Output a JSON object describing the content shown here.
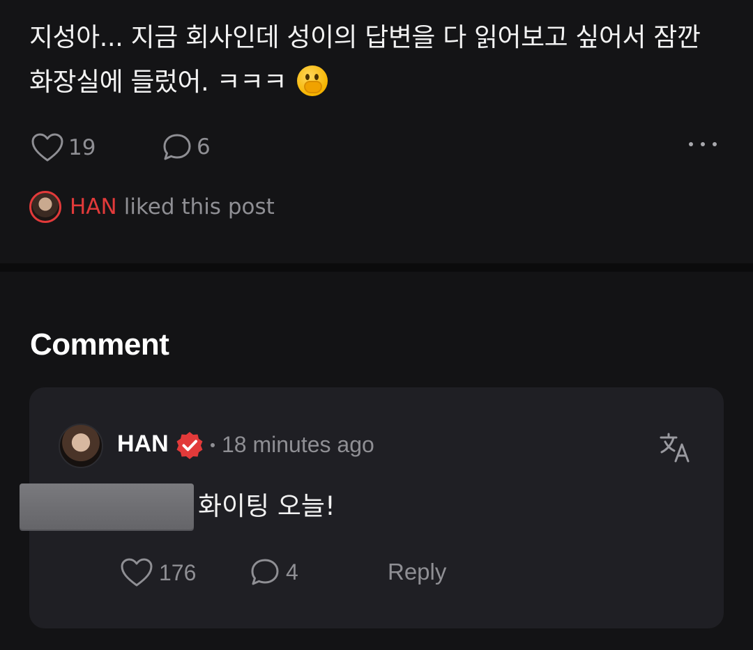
{
  "post": {
    "text": "지성아... 지금 회사인데 성이의 답변을 다 읽어보고 싶어서 잠깐 화장실에 들렀어. ㅋㅋㅋ",
    "emoji": "face-with-hand-over-mouth",
    "likes": "19",
    "comments": "6",
    "liked_by": {
      "name": "HAN",
      "text": "liked this post"
    }
  },
  "comment_section": {
    "heading": "Comment",
    "comments": [
      {
        "author": "HAN",
        "verified": true,
        "time": "18 minutes ago",
        "body": "화이팅 오늘!",
        "likes": "176",
        "replies": "4",
        "reply_label": "Reply"
      }
    ]
  },
  "colors": {
    "background": "#141416",
    "card": "#1f1f24",
    "accent_red": "#e23a3a",
    "muted_text": "#8f8f94"
  }
}
